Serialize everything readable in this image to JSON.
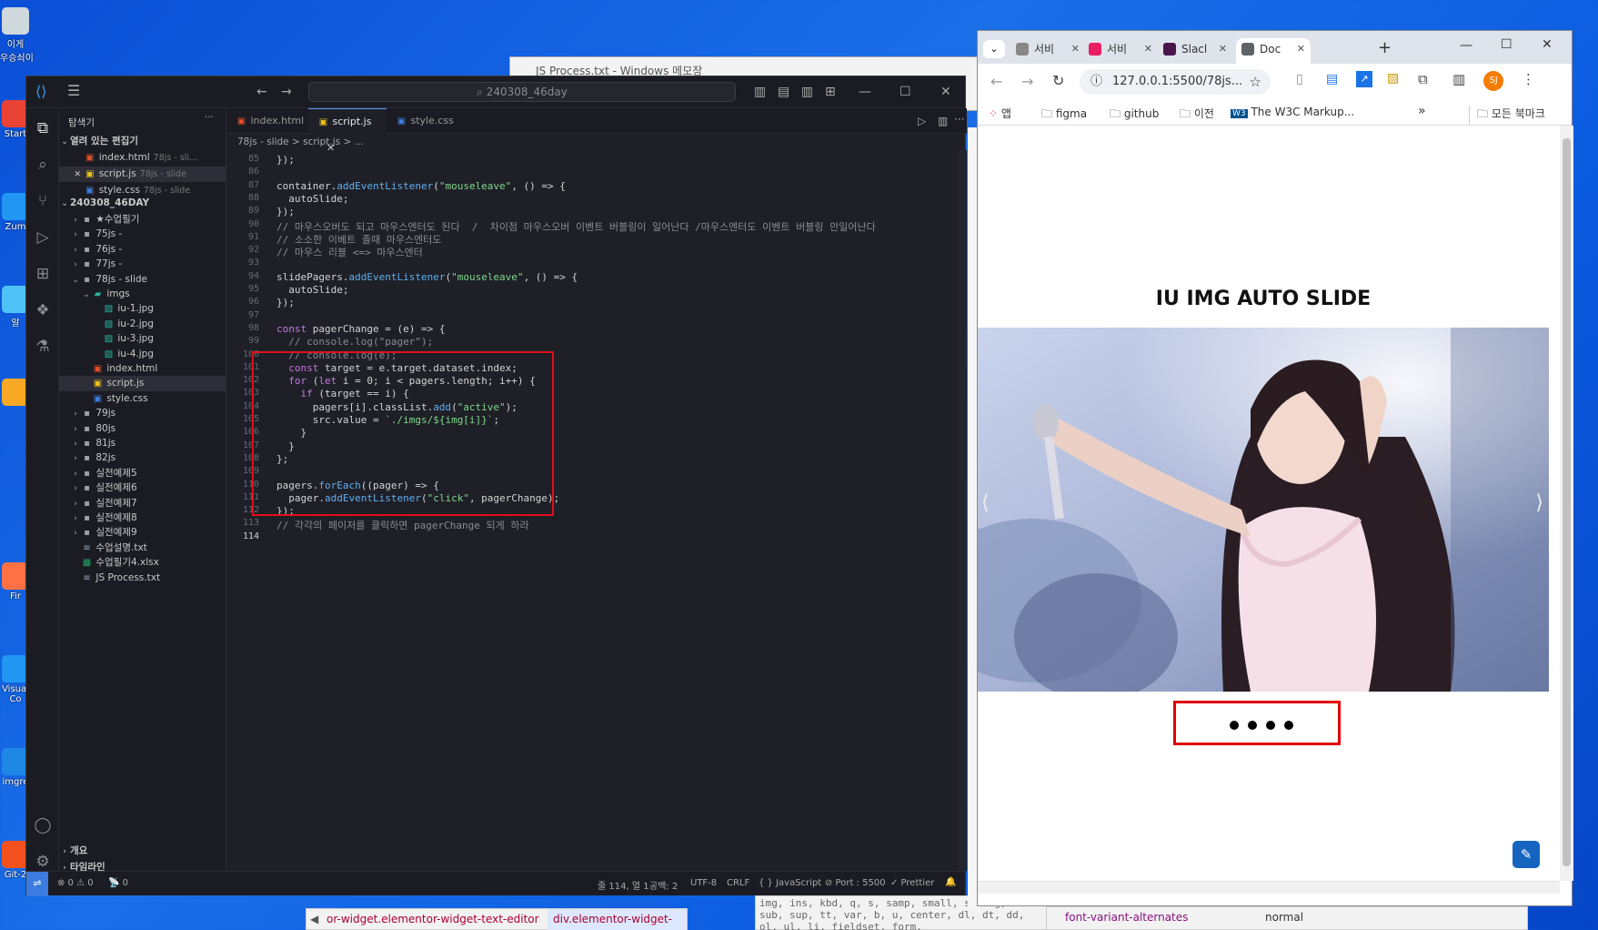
{
  "desktop": {
    "icons": [
      {
        "label": "이게\n우승쇠이",
        "color": "#cfd8dc"
      },
      {
        "label": "Start",
        "color": "#ea4335"
      },
      {
        "label": "Zum",
        "color": "#2196f3"
      },
      {
        "label": "알",
        "color": "#4fc3f7"
      },
      {
        "label": "",
        "color": "#f9a825"
      },
      {
        "label": "Fir",
        "color": "#ff7043"
      },
      {
        "label": "Visual\nCo",
        "color": "#2196f3"
      },
      {
        "label": "imgre",
        "color": "#1e88e5"
      },
      {
        "label": "Git-2",
        "color": "#f4511e"
      }
    ]
  },
  "notepad": {
    "title": "JS Process.txt - Windows 메모장"
  },
  "vscode": {
    "search": "240308_46day",
    "sidebar_title": "탐색기",
    "open_editors": "열려 있는 편집기",
    "open_files": [
      {
        "name": "index.html",
        "desc": "78js - sli...",
        "icon": "html"
      },
      {
        "name": "script.js",
        "desc": "78js - slide",
        "icon": "js",
        "close": "✕"
      },
      {
        "name": "style.css",
        "desc": "78js - slide",
        "icon": "css"
      }
    ],
    "workspace": "240308_46DAY",
    "tree": [
      {
        "name": "★수업필기",
        "lvl": 1,
        "type": "folder"
      },
      {
        "name": "75js -",
        "lvl": 1,
        "type": "folder"
      },
      {
        "name": "76js -",
        "lvl": 1,
        "type": "folder"
      },
      {
        "name": "77js -",
        "lvl": 1,
        "type": "folder"
      },
      {
        "name": "78js - slide",
        "lvl": 1,
        "type": "folder-open"
      },
      {
        "name": "imgs",
        "lvl": 2,
        "type": "imgfolder"
      },
      {
        "name": "iu-1.jpg",
        "lvl": 3,
        "type": "img"
      },
      {
        "name": "iu-2.jpg",
        "lvl": 3,
        "type": "img"
      },
      {
        "name": "iu-3.jpg",
        "lvl": 3,
        "type": "img"
      },
      {
        "name": "iu-4.jpg",
        "lvl": 3,
        "type": "img"
      },
      {
        "name": "index.html",
        "lvl": 2,
        "type": "html"
      },
      {
        "name": "script.js",
        "lvl": 2,
        "type": "js",
        "selected": true
      },
      {
        "name": "style.css",
        "lvl": 2,
        "type": "css"
      },
      {
        "name": "79js",
        "lvl": 1,
        "type": "folder"
      },
      {
        "name": "80js",
        "lvl": 1,
        "type": "folder"
      },
      {
        "name": "81js",
        "lvl": 1,
        "type": "folder"
      },
      {
        "name": "82js",
        "lvl": 1,
        "type": "folder"
      },
      {
        "name": "실전예제5",
        "lvl": 1,
        "type": "folder"
      },
      {
        "name": "실전예제6",
        "lvl": 1,
        "type": "folder"
      },
      {
        "name": "실전예제7",
        "lvl": 1,
        "type": "folder"
      },
      {
        "name": "실전예제8",
        "lvl": 1,
        "type": "folder"
      },
      {
        "name": "실전예제9",
        "lvl": 1,
        "type": "folder"
      },
      {
        "name": "수업설명.txt",
        "lvl": 1,
        "type": "txt"
      },
      {
        "name": "수업필기4.xlsx",
        "lvl": 1,
        "type": "xlsx"
      },
      {
        "name": "JS Process.txt",
        "lvl": 1,
        "type": "txt"
      }
    ],
    "outline": "개요",
    "timeline": "타임라인",
    "tabs": [
      {
        "label": "index.html",
        "icon": "html"
      },
      {
        "label": "script.js",
        "icon": "js",
        "active": true,
        "close": "✕"
      },
      {
        "label": "style.css",
        "icon": "css"
      }
    ],
    "breadcrumb": "78js - slide  >  script.js  >  ...",
    "code_lines": [
      {
        "n": "85",
        "t": "});"
      },
      {
        "n": "86",
        "t": ""
      },
      {
        "n": "87",
        "t": "container.addEventListener(\"mouseleave\", () => {"
      },
      {
        "n": "88",
        "t": "  autoSlide;"
      },
      {
        "n": "89",
        "t": "});"
      },
      {
        "n": "90",
        "t": "// 마우스오버도 되고 마우스엔터도 된다  /  차이점 마우스오버 이벤트 버블링이 일어난다 /마우스엔터도 이벤트 버블링 안일어난다"
      },
      {
        "n": "91",
        "t": "// 소소한 이베트 졸때 마우스엔터도"
      },
      {
        "n": "92",
        "t": "// 마우스 리블 <=> 마우스엔터"
      },
      {
        "n": "93",
        "t": ""
      },
      {
        "n": "94",
        "t": "slidePagers.addEventListener(\"mouseleave\", () => {"
      },
      {
        "n": "95",
        "t": "  autoSlide;"
      },
      {
        "n": "96",
        "t": "});"
      },
      {
        "n": "97",
        "t": ""
      },
      {
        "n": "98",
        "t": "const pagerChange = (e) => {"
      },
      {
        "n": "99",
        "t": "  // console.log(\"pager\");"
      },
      {
        "n": "100",
        "t": "  // console.log(e);"
      },
      {
        "n": "101",
        "t": "  const target = e.target.dataset.index;"
      },
      {
        "n": "102",
        "t": "  for (let i = 0; i < pagers.length; i++) {"
      },
      {
        "n": "103",
        "t": "    if (target == i) {"
      },
      {
        "n": "104",
        "t": "      pagers[i].classList.add(\"active\");"
      },
      {
        "n": "105",
        "t": "      src.value = `./imgs/${img[i]}`;"
      },
      {
        "n": "106",
        "t": "    }"
      },
      {
        "n": "107",
        "t": "  }"
      },
      {
        "n": "108",
        "t": "};"
      },
      {
        "n": "109",
        "t": ""
      },
      {
        "n": "110",
        "t": "pagers.forEach((pager) => {"
      },
      {
        "n": "111",
        "t": "  pager.addEventListener(\"click\", pagerChange);"
      },
      {
        "n": "112",
        "t": "});"
      },
      {
        "n": "113",
        "t": "// 각각의 페이저를 클릭하면 pagerChange 되게 하라"
      },
      {
        "n": "114",
        "t": ""
      }
    ],
    "status": {
      "errors": "⊗ 0 ⚠ 0",
      "ports": "📡 0",
      "position": "줄 114, 열 1",
      "spaces": "공백: 2",
      "encoding": "UTF-8",
      "eol": "CRLF",
      "language": "{ } JavaScript",
      "port": "⊘ Port : 5500",
      "prettier": "✓ Prettier"
    }
  },
  "chrome": {
    "tabs": [
      {
        "label": "서비",
        "fav": "#888888",
        "close": "✕"
      },
      {
        "label": "서비",
        "fav": "#e91e63",
        "close": "✕"
      },
      {
        "label": "Slacl",
        "fav": "#4a154b",
        "close": "✕"
      },
      {
        "label": "Doc",
        "fav": "#5f6368",
        "close": "✕",
        "active": true
      }
    ],
    "new_tab": "+",
    "url": "127.0.0.1:5500/78js...",
    "profile": "SJ",
    "bookmarks": [
      "앱",
      "figma",
      "github",
      "이전",
      "The W3C Markup...",
      "모든 북마크"
    ],
    "page_title": "IU IMG AUTO SLIDE",
    "pagers_count": 4
  },
  "devtools": {
    "crumb1": "or-widget.elementor-widget-text-editor",
    "crumb2": "div.elementor-widget-container",
    "css_prop": "font-variant-alternates",
    "css_val": "normal",
    "css_text": "img, ins, kbd, q, s, samp, small, strong, sub, sup, tt, var, b, u, center, dl, dt, dd, ol, ul, li, fieldset, form,"
  }
}
